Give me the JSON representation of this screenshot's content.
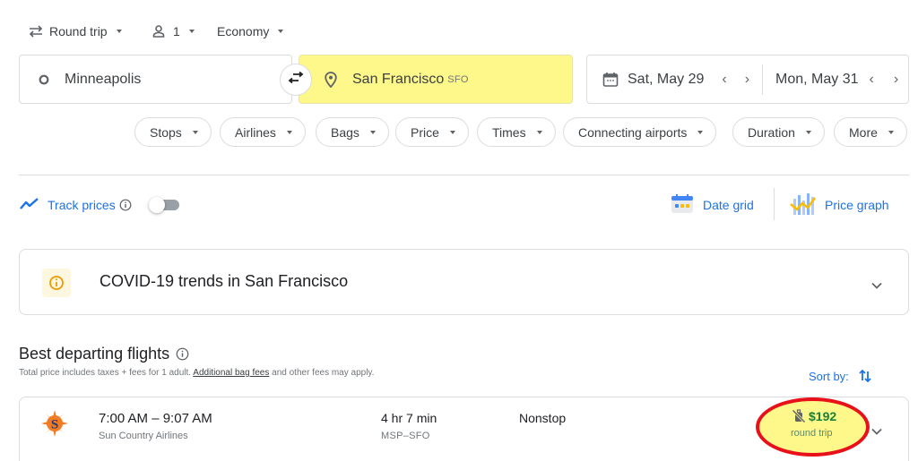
{
  "options": {
    "trip_type": {
      "label": "Round trip",
      "icon": "swap-horiz-icon"
    },
    "passengers": {
      "label": "1",
      "icon": "person-icon"
    },
    "cabin": {
      "label": "Economy"
    }
  },
  "search": {
    "origin": {
      "value": "Minneapolis",
      "icon": "circle-icon"
    },
    "destination": {
      "value": "San Francisco",
      "code": "SFO",
      "icon": "location-pin-icon",
      "highlight": "#fef78a"
    },
    "swap_icon": "swap-arrows-icon",
    "depart_date": "Sat, May 29",
    "return_date": "Mon, May 31",
    "prev_glyph": "‹",
    "next_glyph": "›"
  },
  "filters": [
    {
      "label": "Stops"
    },
    {
      "label": "Airlines"
    },
    {
      "label": "Bags"
    },
    {
      "label": "Price"
    },
    {
      "label": "Times"
    },
    {
      "label": "Connecting airports"
    },
    {
      "label": "Duration"
    },
    {
      "label": "More"
    }
  ],
  "tools": {
    "track_prices": {
      "label": "Track prices",
      "enabled": false
    },
    "date_grid": {
      "label": "Date grid"
    },
    "price_graph": {
      "label": "Price graph"
    }
  },
  "covid_card": {
    "title": "COVID-19 trends in San Francisco"
  },
  "results": {
    "title": "Best departing flights",
    "subtitle_prefix": "Total price includes taxes + fees for 1 adult. ",
    "subtitle_link": "Additional bag fees",
    "subtitle_suffix": " and other fees may apply.",
    "sort_label": "Sort by:",
    "flights": [
      {
        "times": "7:00 AM – 9:07 AM",
        "airline": "Sun Country Airlines",
        "duration": "4 hr 7 min",
        "route": "MSP–SFO",
        "stops": "Nonstop",
        "price": "$192",
        "price_note": "round trip",
        "bag_icon": "no-carry-on-bag-icon"
      }
    ]
  },
  "colors": {
    "accent": "#1a73e8",
    "price_green": "#188038",
    "highlight_yellow": "#fef78a",
    "annotation_red": "#e8111a",
    "airline_orange": "#f37b21",
    "airline_navy": "#1d3c78"
  }
}
